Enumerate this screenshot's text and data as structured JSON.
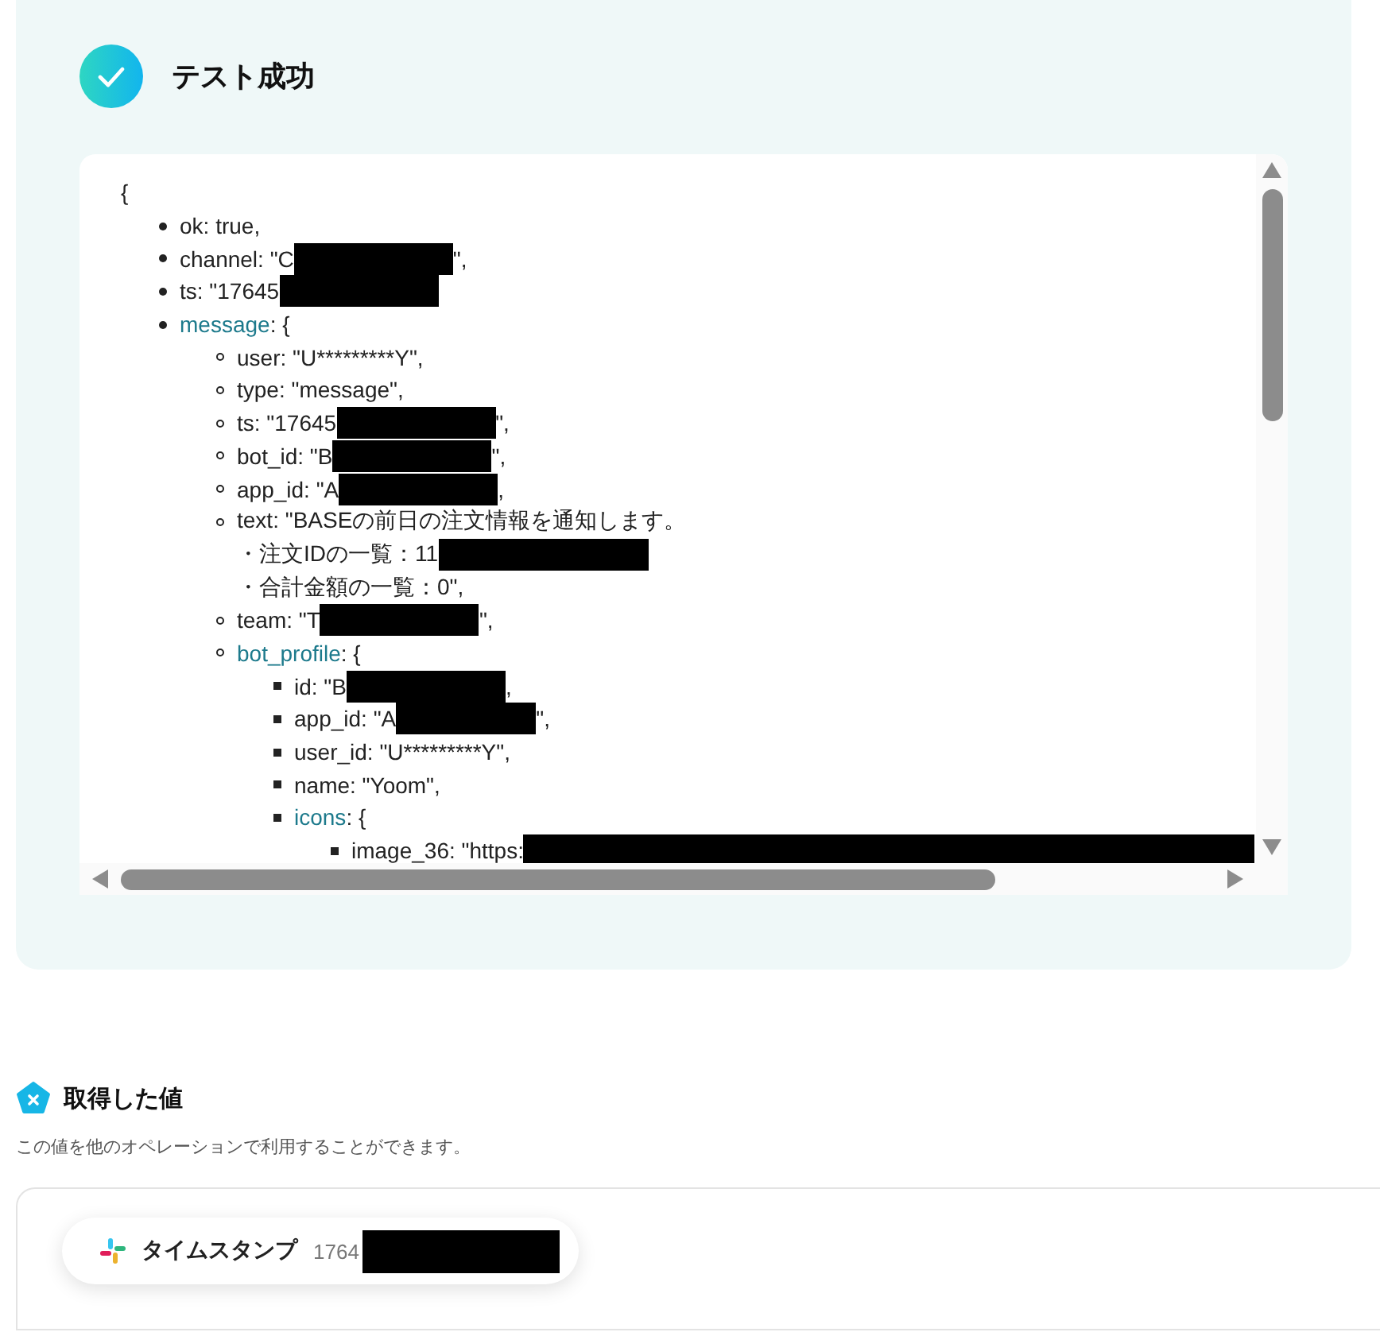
{
  "result": {
    "title": "テスト成功",
    "open": "{",
    "items": [
      {
        "kind": "entry",
        "parts": [
          {
            "kind": "text",
            "text": "ok: true,"
          }
        ]
      },
      {
        "kind": "entry",
        "parts": [
          {
            "kind": "text",
            "text": "channel: \"C"
          },
          {
            "kind": "redacted"
          },
          {
            "kind": "text",
            "text": "\","
          }
        ]
      },
      {
        "kind": "entry",
        "parts": [
          {
            "kind": "text",
            "text": "ts: \"17645"
          },
          {
            "kind": "redacted"
          }
        ]
      },
      {
        "kind": "entry",
        "parts": [
          {
            "kind": "key",
            "text": "message"
          },
          {
            "kind": "text",
            "text": ": {"
          }
        ],
        "children": [
          {
            "kind": "entry",
            "parts": [
              {
                "kind": "text",
                "text": "user: \"U*********Y\","
              }
            ]
          },
          {
            "kind": "entry",
            "parts": [
              {
                "kind": "text",
                "text": "type: \"message\","
              }
            ]
          },
          {
            "kind": "entry",
            "parts": [
              {
                "kind": "text",
                "text": "ts: \"17645"
              },
              {
                "kind": "redacted"
              },
              {
                "kind": "text",
                "text": "\","
              }
            ]
          },
          {
            "kind": "entry",
            "parts": [
              {
                "kind": "text",
                "text": "bot_id: \"B"
              },
              {
                "kind": "redacted"
              },
              {
                "kind": "text",
                "text": "\","
              }
            ]
          },
          {
            "kind": "entry",
            "parts": [
              {
                "kind": "text",
                "text": "app_id: \"A"
              },
              {
                "kind": "redacted"
              },
              {
                "kind": "text",
                "text": ","
              }
            ]
          },
          {
            "kind": "entry",
            "parts": [
              {
                "kind": "text",
                "text": "text: \"BASEの前日の注文情報を通知します。"
              }
            ]
          },
          {
            "kind": "continuation",
            "parts": [
              {
                "kind": "text",
                "text": "・注文IDの一覧：11"
              },
              {
                "kind": "redacted_long"
              }
            ]
          },
          {
            "kind": "continuation",
            "parts": [
              {
                "kind": "text",
                "text": "・合計金額の一覧：0\","
              }
            ]
          },
          {
            "kind": "entry",
            "parts": [
              {
                "kind": "text",
                "text": "team: \"T"
              },
              {
                "kind": "redacted"
              },
              {
                "kind": "text",
                "text": "\","
              }
            ]
          },
          {
            "kind": "entry",
            "parts": [
              {
                "kind": "key",
                "text": "bot_profile"
              },
              {
                "kind": "text",
                "text": ": {"
              }
            ],
            "children": [
              {
                "kind": "entry",
                "parts": [
                  {
                    "kind": "text",
                    "text": "id: \"B"
                  },
                  {
                    "kind": "redacted"
                  },
                  {
                    "kind": "text",
                    "text": ","
                  }
                ]
              },
              {
                "kind": "entry",
                "parts": [
                  {
                    "kind": "text",
                    "text": "app_id: \"A"
                  },
                  {
                    "kind": "redacted_short"
                  },
                  {
                    "kind": "text",
                    "text": "\","
                  }
                ]
              },
              {
                "kind": "entry",
                "parts": [
                  {
                    "kind": "text",
                    "text": "user_id: \"U*********Y\","
                  }
                ]
              },
              {
                "kind": "entry",
                "parts": [
                  {
                    "kind": "text",
                    "text": "name: \"Yoom\","
                  }
                ]
              },
              {
                "kind": "entry",
                "parts": [
                  {
                    "kind": "key",
                    "text": "icons"
                  },
                  {
                    "kind": "text",
                    "text": ": {"
                  }
                ],
                "children": [
                  {
                    "kind": "entry",
                    "parts": [
                      {
                        "kind": "text",
                        "text": "image_36: \"https:"
                      },
                      {
                        "kind": "redacted_edge"
                      }
                    ]
                  }
                ]
              }
            ]
          }
        ]
      }
    ]
  },
  "values": {
    "title": "取得した値",
    "description": "この値を他のオペレーションで利用することができます。",
    "items": [
      {
        "label": "タイムスタンプ",
        "value": "1764",
        "redacted": true
      }
    ]
  }
}
